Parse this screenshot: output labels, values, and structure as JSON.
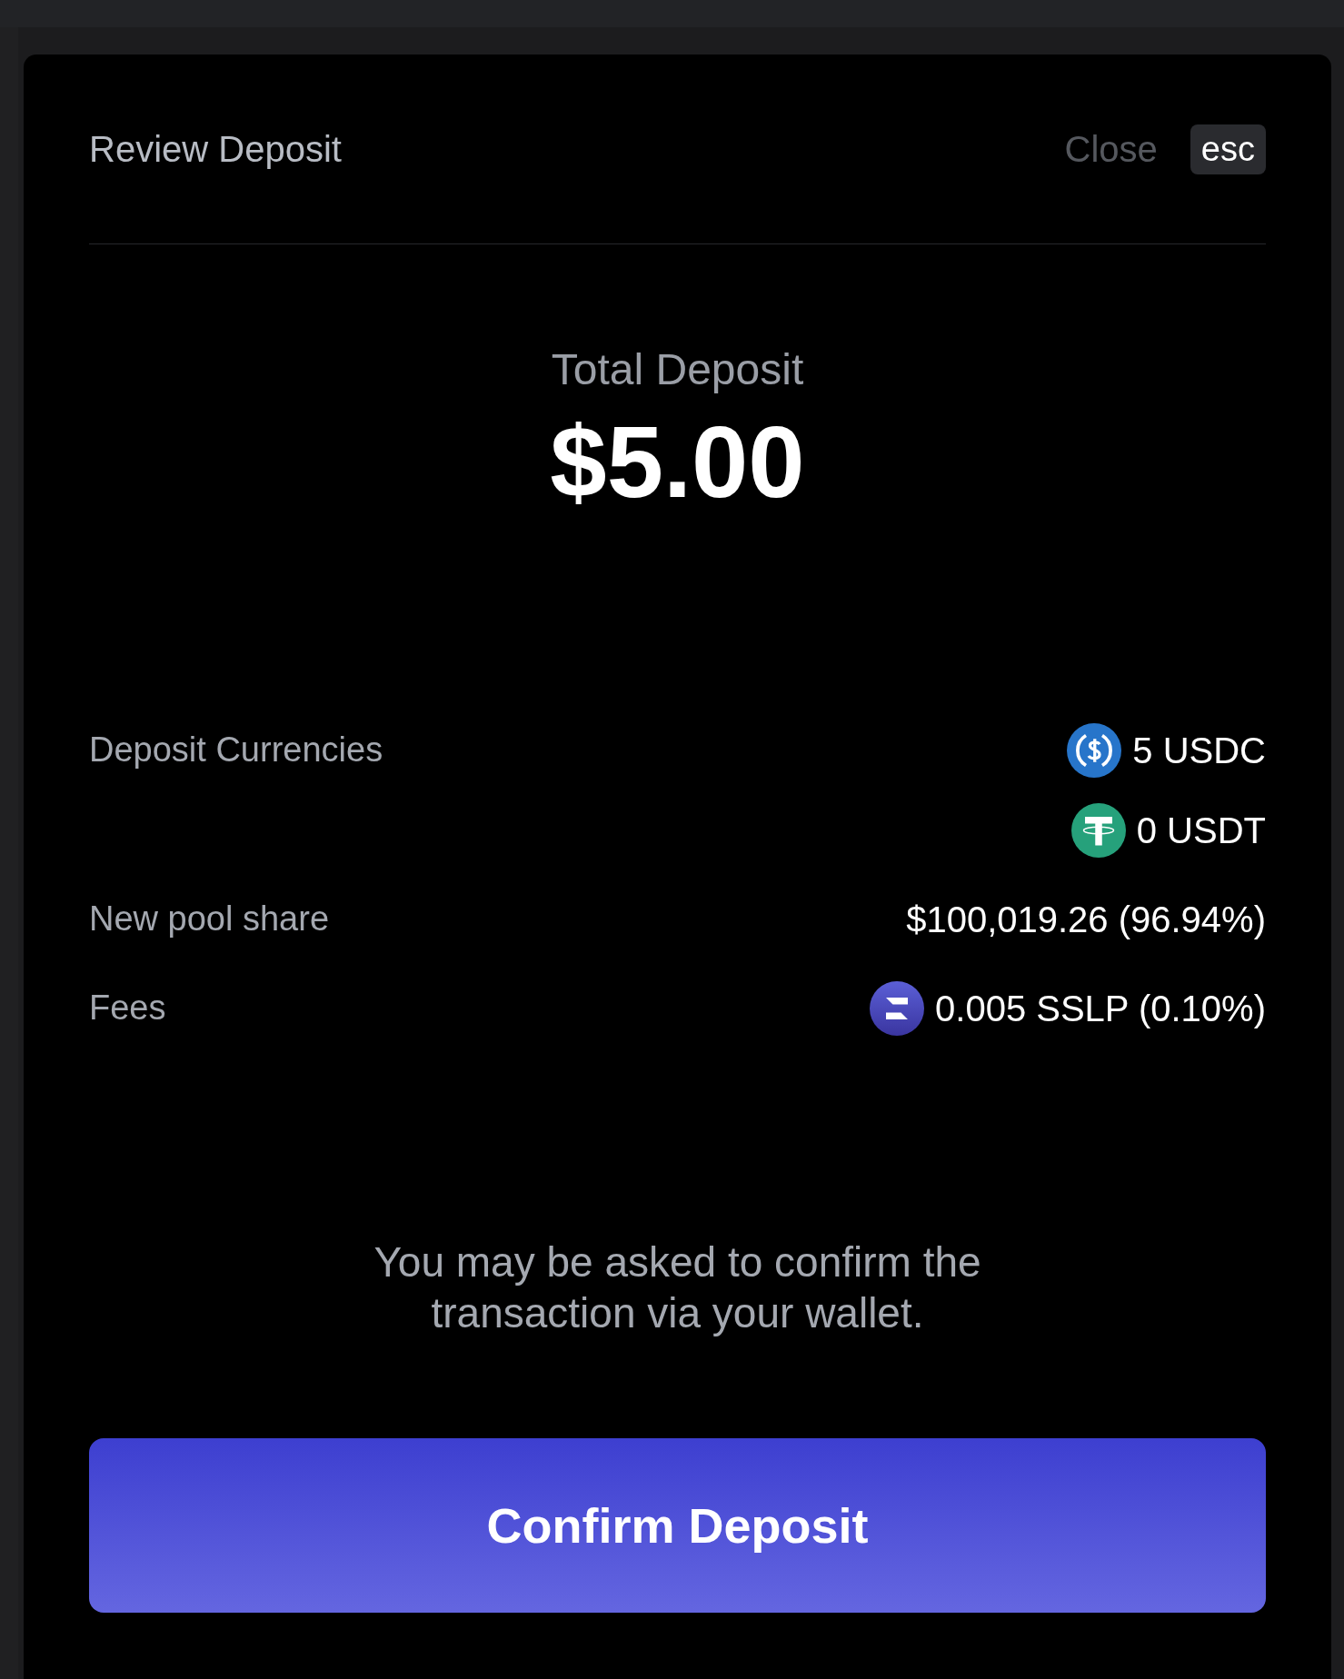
{
  "dialog": {
    "title": "Review Deposit",
    "close_label": "Close",
    "close_key": "esc"
  },
  "total": {
    "label": "Total Deposit",
    "amount": "$5.00"
  },
  "details": [
    {
      "label": "Deposit Currencies",
      "values": [
        {
          "kind": "usdc",
          "text": "5 USDC"
        },
        {
          "kind": "usdt",
          "text": "0 USDT"
        }
      ]
    },
    {
      "label": "New pool share",
      "values": [
        {
          "text": "$100,019.26 (96.94%)"
        }
      ]
    },
    {
      "label": "Fees",
      "values": [
        {
          "kind": "sslp",
          "text": "0.005 SSLP (0.10%)"
        }
      ]
    }
  ],
  "note": "You may be asked to confirm the transaction via your wallet.",
  "confirm_button": "Confirm Deposit"
}
